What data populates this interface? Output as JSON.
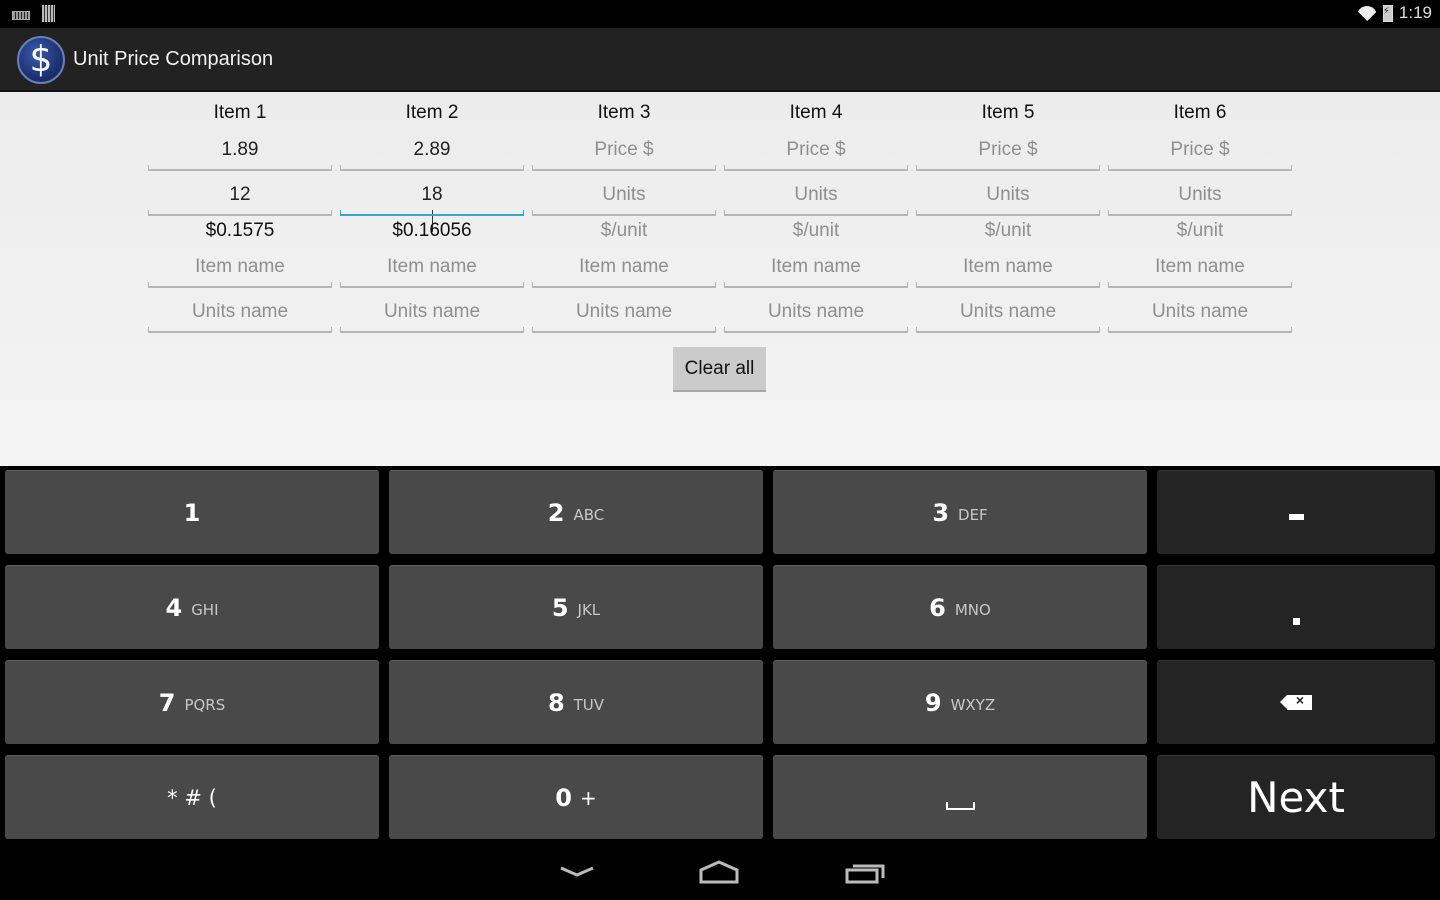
{
  "status_bar": {
    "time": "1:19",
    "left_icons": [
      "keyboard-icon",
      "barcode-icon"
    ],
    "right_icons": [
      "wifi-icon",
      "battery-charging-icon"
    ]
  },
  "action_bar": {
    "app_icon": "dollar-icon",
    "app_icon_glyph": "$",
    "title": "Unit Price Comparison"
  },
  "items": [
    {
      "header": "Item 1",
      "price": {
        "value": "1.89",
        "placeholder": "Price $"
      },
      "units": {
        "value": "12",
        "placeholder": "Units"
      },
      "unit_price": {
        "value": "$0.1575",
        "placeholder": "$/unit"
      },
      "item_name": {
        "value": "",
        "placeholder": "Item name"
      },
      "units_name": {
        "value": "",
        "placeholder": "Units name"
      },
      "focused_field": null
    },
    {
      "header": "Item 2",
      "price": {
        "value": "2.89",
        "placeholder": "Price $"
      },
      "units": {
        "value": "18",
        "placeholder": "Units"
      },
      "unit_price": {
        "value": "$0.16056",
        "placeholder": "$/unit"
      },
      "item_name": {
        "value": "",
        "placeholder": "Item name"
      },
      "units_name": {
        "value": "",
        "placeholder": "Units name"
      },
      "focused_field": "units"
    },
    {
      "header": "Item 3",
      "price": {
        "value": "",
        "placeholder": "Price $"
      },
      "units": {
        "value": "",
        "placeholder": "Units"
      },
      "unit_price": {
        "value": "",
        "placeholder": "$/unit"
      },
      "item_name": {
        "value": "",
        "placeholder": "Item name"
      },
      "units_name": {
        "value": "",
        "placeholder": "Units name"
      },
      "focused_field": null
    },
    {
      "header": "Item 4",
      "price": {
        "value": "",
        "placeholder": "Price $"
      },
      "units": {
        "value": "",
        "placeholder": "Units"
      },
      "unit_price": {
        "value": "",
        "placeholder": "$/unit"
      },
      "item_name": {
        "value": "",
        "placeholder": "Item name"
      },
      "units_name": {
        "value": "",
        "placeholder": "Units name"
      },
      "focused_field": null
    },
    {
      "header": "Item 5",
      "price": {
        "value": "",
        "placeholder": "Price $"
      },
      "units": {
        "value": "",
        "placeholder": "Units"
      },
      "unit_price": {
        "value": "",
        "placeholder": "$/unit"
      },
      "item_name": {
        "value": "",
        "placeholder": "Item name"
      },
      "units_name": {
        "value": "",
        "placeholder": "Units name"
      },
      "focused_field": null
    },
    {
      "header": "Item 6",
      "price": {
        "value": "",
        "placeholder": "Price $"
      },
      "units": {
        "value": "",
        "placeholder": "Units"
      },
      "unit_price": {
        "value": "",
        "placeholder": "$/unit"
      },
      "item_name": {
        "value": "",
        "placeholder": "Item name"
      },
      "units_name": {
        "value": "",
        "placeholder": "Units name"
      },
      "focused_field": null
    }
  ],
  "clear_all_label": "Clear all",
  "keyboard": {
    "rows": [
      [
        {
          "num": "1",
          "sub": ""
        },
        {
          "num": "2",
          "sub": "ABC"
        },
        {
          "num": "3",
          "sub": "DEF"
        },
        {
          "action": "minus",
          "icon": "minus-icon"
        }
      ],
      [
        {
          "num": "4",
          "sub": "GHI"
        },
        {
          "num": "5",
          "sub": "JKL"
        },
        {
          "num": "6",
          "sub": "MNO"
        },
        {
          "action": "period",
          "icon": "period-icon"
        }
      ],
      [
        {
          "num": "7",
          "sub": "PQRS"
        },
        {
          "num": "8",
          "sub": "TUV"
        },
        {
          "num": "9",
          "sub": "WXYZ"
        },
        {
          "action": "backspace",
          "icon": "backspace-icon"
        }
      ],
      [
        {
          "symbols": "* # ("
        },
        {
          "num": "0",
          "sub": "+"
        },
        {
          "action": "space",
          "icon": "space-icon"
        },
        {
          "action": "next",
          "label": "Next"
        }
      ]
    ]
  },
  "nav_bar": {
    "buttons": [
      "back-icon",
      "home-icon",
      "recent-apps-icon"
    ]
  },
  "colors": {
    "focus_accent": "#33a7d6",
    "action_bar": "#222222",
    "key_light": "#494949",
    "key_dark": "#242424"
  }
}
